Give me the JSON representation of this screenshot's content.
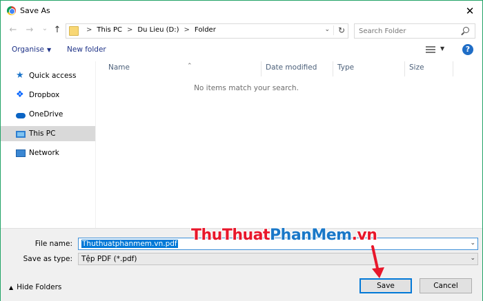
{
  "window": {
    "title": "Save As",
    "close_glyph": "✕",
    "accent": "#21a366"
  },
  "nav": {
    "back_glyph": "←",
    "forward_glyph": "→",
    "recent_glyph": "⌄",
    "up_glyph": "↑",
    "breadcrumbs": [
      "This PC",
      "Du Lieu (D:)",
      "Folder"
    ],
    "breadcrumb_sep": ">",
    "refresh_glyph": "↻",
    "search_placeholder": "Search Folder"
  },
  "toolbar": {
    "organise": "Organise",
    "new_folder": "New folder",
    "help": "?"
  },
  "sidebar": {
    "items": [
      {
        "label": "Quick access",
        "icon": "star-icon"
      },
      {
        "label": "Dropbox",
        "icon": "dropbox-icon"
      },
      {
        "label": "OneDrive",
        "icon": "cloud-icon"
      },
      {
        "label": "This PC",
        "icon": "computer-icon",
        "selected": true
      },
      {
        "label": "Network",
        "icon": "network-icon"
      }
    ]
  },
  "filelist": {
    "columns": [
      "Name",
      "Date modified",
      "Type",
      "Size"
    ],
    "empty_message": "No items match your search."
  },
  "form": {
    "file_name_label": "File name:",
    "file_name_value": "Thuthuatphanmem.vn.pdf",
    "save_type_label": "Save as type:",
    "save_type_value": "Tệp PDF (*.pdf)"
  },
  "footer": {
    "hide_folders": "Hide Folders",
    "save": "Save",
    "cancel": "Cancel"
  },
  "watermark": {
    "part1": "ThuThuat",
    "part2": "PhanMem",
    "part3": ".vn",
    "red": "#e8172b",
    "blue": "#1a78c8"
  }
}
